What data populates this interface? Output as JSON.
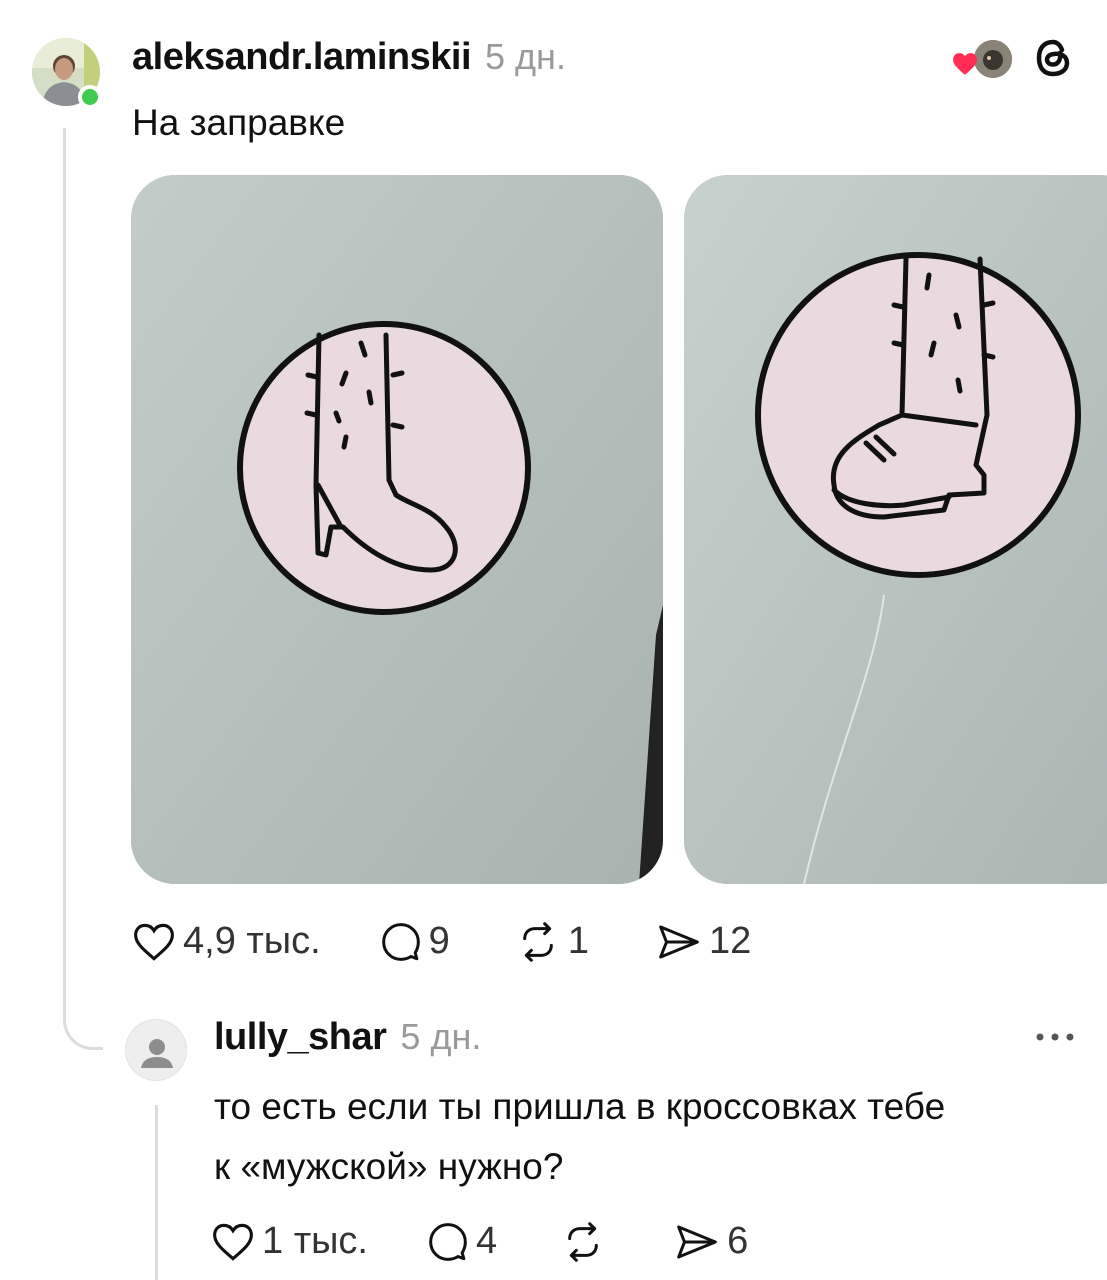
{
  "post": {
    "username": "aleksandr.laminskii",
    "time": "5 дн.",
    "text": "На заправке",
    "actions": {
      "likes": "4,9 тыс.",
      "comments": "9",
      "reposts": "1",
      "shares": "12"
    }
  },
  "reply": {
    "username": "lully_shar",
    "time": "5 дн.",
    "text_line1": "то есть если ты пришла в кроссовках тебе",
    "text_line2": "к «мужской» нужно?",
    "actions": {
      "likes": "1 тыс.",
      "comments": "4",
      "reposts": "",
      "shares": "6"
    }
  },
  "colors": {
    "accent_heart": "#ff2d55",
    "online": "#3ecb4f",
    "muted": "#9a9a9a",
    "photo_bg": "#b3bdba",
    "sign_circle": "#ead9df"
  },
  "icons": [
    "heart-icon",
    "comment-icon",
    "repost-icon",
    "share-icon",
    "threads-logo-icon",
    "more-icon",
    "default-avatar-icon"
  ]
}
